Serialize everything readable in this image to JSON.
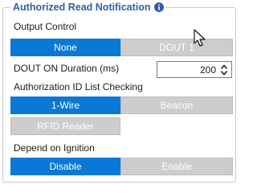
{
  "panel": {
    "title": "Authorized Read Notification"
  },
  "output_control": {
    "label": "Output Control",
    "options": [
      "None",
      "DOUT 1"
    ],
    "selected": "None"
  },
  "dout_on_duration": {
    "label": "DOUT ON Duration (ms)",
    "value": "200"
  },
  "authorization_id": {
    "label": "Authorization ID List Checking",
    "options": [
      "1-Wire",
      "Beacon",
      "RFID Reader"
    ],
    "selected": "1-Wire"
  },
  "depend_on_ignition": {
    "label": "Depend on Ignition",
    "options": [
      "Disable",
      "Enable"
    ],
    "selected": "Disable"
  },
  "icons": {
    "info": "info-icon",
    "spin_up": "chevron-up-icon",
    "spin_down": "chevron-down-icon",
    "cursor": "mouse-pointer-icon"
  },
  "colors": {
    "accent": "#0a78d7",
    "inactive": "#cdcdcd",
    "title": "#2f5fa7"
  }
}
